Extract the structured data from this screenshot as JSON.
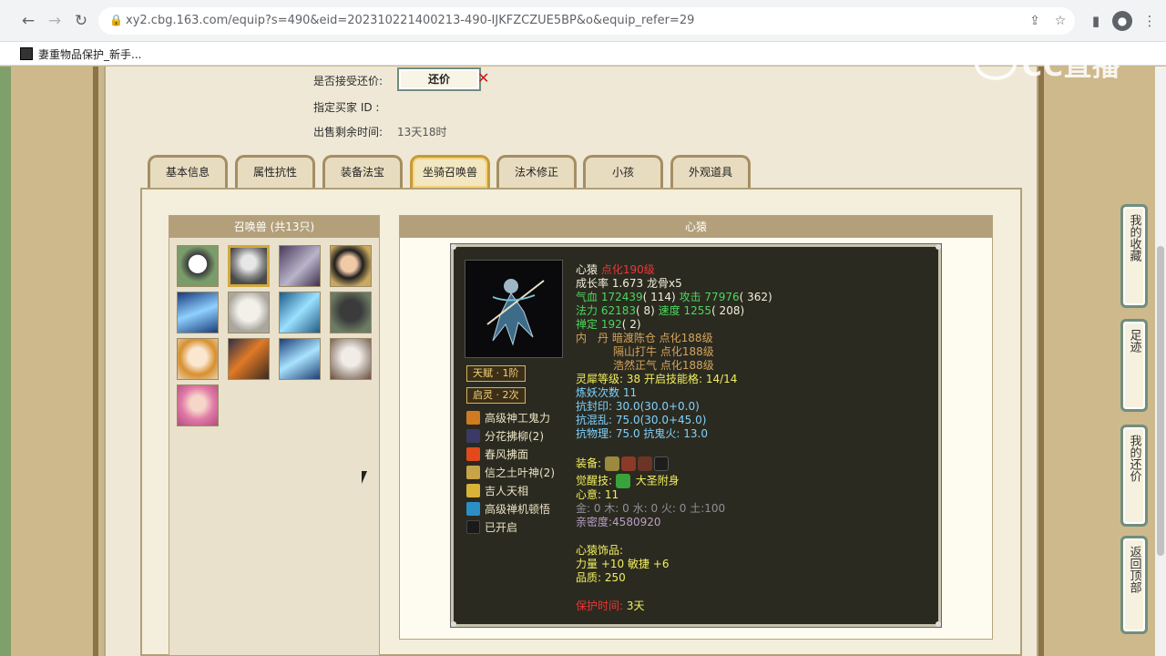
{
  "browser": {
    "url": "xy2.cbg.163.com/equip?s=490&eid=202310221400213-490-IJKFZCZUE5BP&o&equip_refer=29",
    "bookmark_label": "妻重物品保护_新手..."
  },
  "watermark": {
    "text": "CC直播"
  },
  "sale_info": {
    "accept_counter_label": "是否接受还价:",
    "counter_button": "还价",
    "buyer_id_label": "指定买家 ID :",
    "remaining_time_label": "出售剩余时间:",
    "remaining_time_value": "13天18时"
  },
  "tabs": [
    "基本信息",
    "属性抗性",
    "装备法宝",
    "坐骑召唤兽",
    "法术修正",
    "小孩",
    "外观道具"
  ],
  "active_tab": "坐骑召唤兽",
  "pet_list": {
    "header": "召唤兽 (共13只)"
  },
  "pet_detail": {
    "header": "心猿",
    "name": "心猿",
    "level": "点化190级",
    "growth": "成长率 1.673 龙骨x5",
    "hp_label": "气血",
    "hp": "172439",
    "hp_base": "( 114)",
    "atk_label": "攻击",
    "atk": "77976",
    "atk_base": "( 362)",
    "mp_label": "法力",
    "mp": "62183",
    "mp_base": "( 8)",
    "spd_label": "速度",
    "spd": "1255",
    "spd_base": "( 208)",
    "zen_label": "禅定",
    "zen": "192",
    "zen_base": "( 2)",
    "dan_label": "内　丹",
    "dan1": "暗渡陈仓 点化188级",
    "dan2": "隔山打牛 点化188级",
    "dan3": "浩然正气 点化188级",
    "lingxi_label": "灵犀等级:",
    "lingxi_value": "38",
    "lingxi_open_label": "开启技能格:",
    "lingxi_open_value": "14/14",
    "refine_label": "炼妖次数",
    "refine_value": "11",
    "res1": "抗封印: 30.0(30.0+0.0)",
    "res2": "抗混乱: 75.0(30.0+45.0)",
    "res3_a": "抗物理: 75.0",
    "res3_b": "抗鬼火: 13.0",
    "equip_label": "装备:",
    "awake_label": "觉醒技:",
    "awake_value": "大圣附身",
    "heart_label": "心意:",
    "heart_value": "11",
    "elements": "金: 0 木: 0 水: 0 火: 0 土:100",
    "intimacy": "亲密度:4580920",
    "ornament_label": "心猿饰品:",
    "ornament_attr": "力量 +10 敏捷 +6",
    "ornament_quality": "品质:   250",
    "protect_label": "保护时间:",
    "protect_value": "3天",
    "talent_badge": "天赋 · 1阶",
    "inspire_badge": "启灵 · 2次",
    "skills": [
      "高级神工鬼力",
      "分花拂柳(2)",
      "春风拂面",
      "信之土叶神(2)",
      "吉人天相",
      "高级禅机顿悟",
      "已开启"
    ]
  },
  "side_nav": [
    "我的收藏",
    "足迹",
    "我的还价",
    "返回顶部"
  ],
  "colors": {
    "accent_green": "#6f8e7e",
    "gold": "#c59a3a"
  }
}
